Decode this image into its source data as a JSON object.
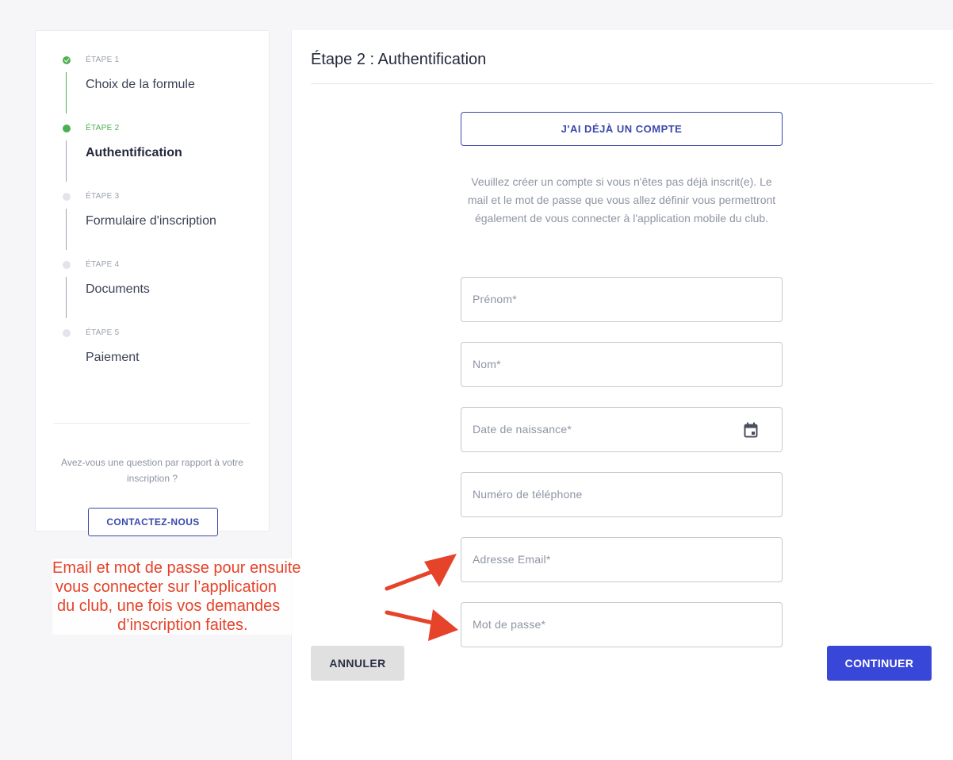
{
  "sidebar": {
    "steps": [
      {
        "kicker": "ÉTAPE 1",
        "title": "Choix de la formule",
        "state": "done"
      },
      {
        "kicker": "ÉTAPE 2",
        "title": "Authentification",
        "state": "active"
      },
      {
        "kicker": "ÉTAPE 3",
        "title": "Formulaire d'inscription",
        "state": "pending"
      },
      {
        "kicker": "ÉTAPE 4",
        "title": "Documents",
        "state": "pending"
      },
      {
        "kicker": "ÉTAPE 5",
        "title": "Paiement",
        "state": "pending"
      }
    ],
    "help_text": "Avez-vous une question par rapport à votre inscription ?",
    "contact_label": "CONTACTEZ-NOUS"
  },
  "main": {
    "title": "Étape 2 : Authentification",
    "account_button": "J'AI DÉJÀ UN COMPTE",
    "info_text": "Veuillez créer un compte si vous n'êtes pas déjà inscrit(e). Le mail et le mot de passe que vous allez définir vous permettront également de vous connecter à l'application mobile du club.",
    "fields": [
      {
        "label": "Prénom*"
      },
      {
        "label": "Nom*"
      },
      {
        "label": "Date de naissance*",
        "icon": "calendar-icon"
      },
      {
        "label": "Numéro de téléphone"
      },
      {
        "label": "Adresse Email*"
      },
      {
        "label": "Mot de passe*"
      }
    ],
    "cancel_label": "ANNULER",
    "continue_label": "CONTINUER"
  },
  "annotation": {
    "lines": [
      "Email et mot de passe pour ensuite",
      "vous connecter sur l’application",
      "du club,   une fois vos demandes",
      "d’inscription faites."
    ],
    "color": "#e5432a"
  },
  "colors": {
    "accent": "#3949ab",
    "primary_button": "#3947d9",
    "step_done": "#4caf50"
  }
}
